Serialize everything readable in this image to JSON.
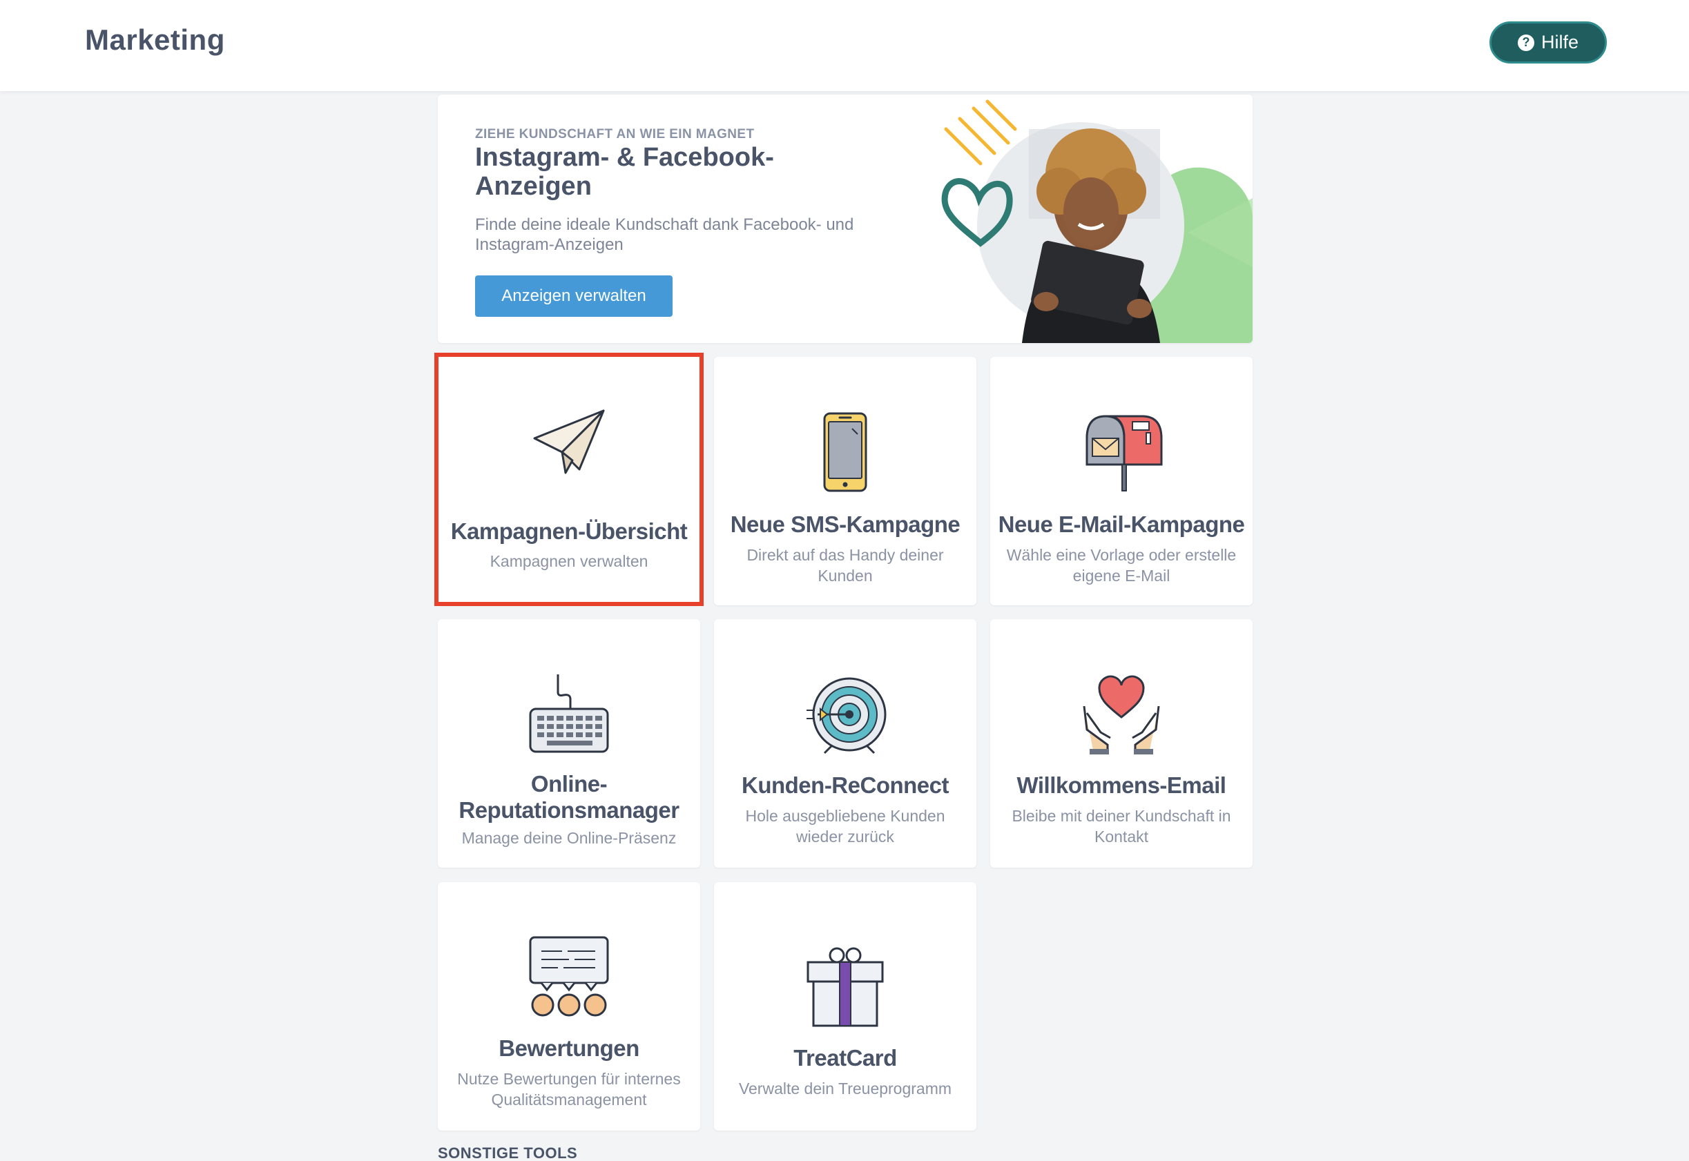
{
  "header": {
    "title": "Marketing",
    "help_label": "Hilfe"
  },
  "banner": {
    "eyebrow": "ZIEHE KUNDSCHAFT AN WIE EIN MAGNET",
    "title": "Instagram- & Facebook-Anzeigen",
    "description": "Finde deine ideale Kundschaft dank Facebook- und Instagram-Anzeigen",
    "button_label": "Anzeigen verwalten"
  },
  "cards": [
    {
      "title": "Kampagnen-Übersicht",
      "subtitle": "Kampagnen verwalten",
      "icon": "paper-plane-icon",
      "highlighted": true
    },
    {
      "title": "Neue SMS-Kampagne",
      "subtitle": "Direkt auf das Handy deiner Kunden",
      "icon": "smartphone-icon"
    },
    {
      "title": "Neue E-Mail-Kampagne",
      "subtitle": "Wähle eine Vorlage oder erstelle eigene E-Mail",
      "icon": "mailbox-icon"
    },
    {
      "title": "Online-Reputationsmanager",
      "subtitle": "Manage deine Online-Präsenz",
      "icon": "keyboard-icon"
    },
    {
      "title": "Kunden-ReConnect",
      "subtitle": "Hole ausgebliebene Kunden wieder zurück",
      "icon": "target-icon"
    },
    {
      "title": "Willkommens-Email",
      "subtitle": "Bleibe mit deiner Kundschaft in Kontakt",
      "icon": "heart-hands-icon"
    },
    {
      "title": "Bewertungen",
      "subtitle": "Nutze Bewertungen für internes Qualitätsmanagement",
      "icon": "reviews-icon"
    },
    {
      "title": "TreatCard",
      "subtitle": "Verwalte dein Treueprogramm",
      "icon": "gift-icon"
    }
  ],
  "section_label": "SONSTIGE TOOLS",
  "colors": {
    "accent_button": "#4499d6",
    "help_button": "#1f5d5e",
    "highlight": "#e8412b",
    "text_primary": "#4a5468"
  }
}
